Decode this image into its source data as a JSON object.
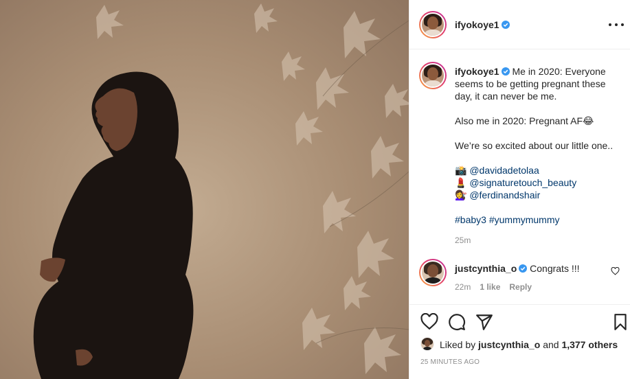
{
  "post": {
    "author": "ifyokoye1",
    "more_icon": "more-horizontal-icon"
  },
  "caption": {
    "author": "ifyokoye1",
    "line1": "Me in 2020: Everyone seems to be getting pregnant these day, it can never be me.",
    "line2": "Also me in 2020: Pregnant AF😂",
    "line3": "We’re so excited about our little one..",
    "credit1_emoji": "📸",
    "credit1_handle": "@davidadetolaa",
    "credit2_emoji": "💄",
    "credit2_handle": "@signaturetouch_beauty",
    "credit3_emoji": "💇‍♀️",
    "credit3_handle": "@ferdinandshair",
    "hashtag1": "#baby3",
    "hashtag2": "#yummymummy",
    "time": "25m"
  },
  "comment": {
    "author": "justcynthia_o",
    "text": "Congrats !!!",
    "time": "22m",
    "likes": "1 like",
    "reply": "Reply"
  },
  "footer": {
    "liked_by_prefix": "Liked by",
    "liked_by_user": "justcynthia_o",
    "and": "and",
    "others": "1,377 others",
    "posted": "25 MINUTES AGO"
  },
  "icons": [
    "heart-icon",
    "comment-icon",
    "share-icon",
    "save-icon"
  ],
  "colors": {
    "verified_blue": "#3897f0",
    "link": "#00376b",
    "muted": "#8e8e8e"
  }
}
